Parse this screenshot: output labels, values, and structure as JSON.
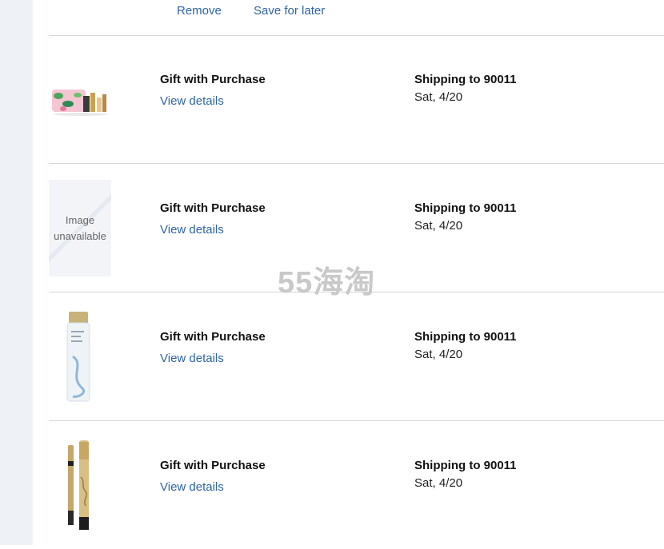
{
  "top_actions": {
    "remove_label": "Remove",
    "save_label": "Save for later"
  },
  "items": [
    {
      "title": "Gift with Purchase",
      "details_label": "View details",
      "shipping": "Shipping to 90011",
      "date": "Sat, 4/20",
      "thumb": "floral-makeup-bag-set"
    },
    {
      "title": "Gift with Purchase",
      "details_label": "View details",
      "shipping": "Shipping to 90011",
      "date": "Sat, 4/20",
      "thumb_text": "Image unavailable"
    },
    {
      "title": "Gift with Purchase",
      "details_label": "View details",
      "shipping": "Shipping to 90011",
      "date": "Sat, 4/20",
      "thumb": "skincare-lotion-bottle"
    },
    {
      "title": "Gift with Purchase",
      "details_label": "View details",
      "shipping": "Shipping to 90011",
      "date": "Sat, 4/20",
      "thumb": "eyeliner-and-mascara"
    }
  ],
  "watermark": "55海淘",
  "colors": {
    "link": "#2f64a8",
    "rail": "#eef2f6",
    "divider": "#d6d6d6"
  }
}
